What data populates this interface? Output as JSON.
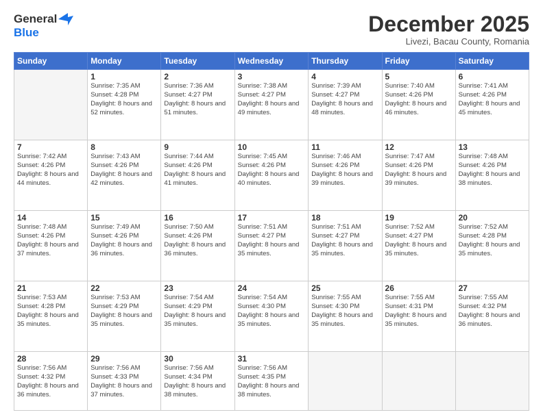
{
  "logo": {
    "line1": "General",
    "line2": "Blue"
  },
  "title": "December 2025",
  "subtitle": "Livezi, Bacau County, Romania",
  "header_days": [
    "Sunday",
    "Monday",
    "Tuesday",
    "Wednesday",
    "Thursday",
    "Friday",
    "Saturday"
  ],
  "weeks": [
    [
      {
        "day": "",
        "info": ""
      },
      {
        "day": "1",
        "info": "Sunrise: 7:35 AM\nSunset: 4:28 PM\nDaylight: 8 hours\nand 52 minutes."
      },
      {
        "day": "2",
        "info": "Sunrise: 7:36 AM\nSunset: 4:27 PM\nDaylight: 8 hours\nand 51 minutes."
      },
      {
        "day": "3",
        "info": "Sunrise: 7:38 AM\nSunset: 4:27 PM\nDaylight: 8 hours\nand 49 minutes."
      },
      {
        "day": "4",
        "info": "Sunrise: 7:39 AM\nSunset: 4:27 PM\nDaylight: 8 hours\nand 48 minutes."
      },
      {
        "day": "5",
        "info": "Sunrise: 7:40 AM\nSunset: 4:26 PM\nDaylight: 8 hours\nand 46 minutes."
      },
      {
        "day": "6",
        "info": "Sunrise: 7:41 AM\nSunset: 4:26 PM\nDaylight: 8 hours\nand 45 minutes."
      }
    ],
    [
      {
        "day": "7",
        "info": "Sunrise: 7:42 AM\nSunset: 4:26 PM\nDaylight: 8 hours\nand 44 minutes."
      },
      {
        "day": "8",
        "info": "Sunrise: 7:43 AM\nSunset: 4:26 PM\nDaylight: 8 hours\nand 42 minutes."
      },
      {
        "day": "9",
        "info": "Sunrise: 7:44 AM\nSunset: 4:26 PM\nDaylight: 8 hours\nand 41 minutes."
      },
      {
        "day": "10",
        "info": "Sunrise: 7:45 AM\nSunset: 4:26 PM\nDaylight: 8 hours\nand 40 minutes."
      },
      {
        "day": "11",
        "info": "Sunrise: 7:46 AM\nSunset: 4:26 PM\nDaylight: 8 hours\nand 39 minutes."
      },
      {
        "day": "12",
        "info": "Sunrise: 7:47 AM\nSunset: 4:26 PM\nDaylight: 8 hours\nand 39 minutes."
      },
      {
        "day": "13",
        "info": "Sunrise: 7:48 AM\nSunset: 4:26 PM\nDaylight: 8 hours\nand 38 minutes."
      }
    ],
    [
      {
        "day": "14",
        "info": "Sunrise: 7:48 AM\nSunset: 4:26 PM\nDaylight: 8 hours\nand 37 minutes."
      },
      {
        "day": "15",
        "info": "Sunrise: 7:49 AM\nSunset: 4:26 PM\nDaylight: 8 hours\nand 36 minutes."
      },
      {
        "day": "16",
        "info": "Sunrise: 7:50 AM\nSunset: 4:26 PM\nDaylight: 8 hours\nand 36 minutes."
      },
      {
        "day": "17",
        "info": "Sunrise: 7:51 AM\nSunset: 4:27 PM\nDaylight: 8 hours\nand 35 minutes."
      },
      {
        "day": "18",
        "info": "Sunrise: 7:51 AM\nSunset: 4:27 PM\nDaylight: 8 hours\nand 35 minutes."
      },
      {
        "day": "19",
        "info": "Sunrise: 7:52 AM\nSunset: 4:27 PM\nDaylight: 8 hours\nand 35 minutes."
      },
      {
        "day": "20",
        "info": "Sunrise: 7:52 AM\nSunset: 4:28 PM\nDaylight: 8 hours\nand 35 minutes."
      }
    ],
    [
      {
        "day": "21",
        "info": "Sunrise: 7:53 AM\nSunset: 4:28 PM\nDaylight: 8 hours\nand 35 minutes."
      },
      {
        "day": "22",
        "info": "Sunrise: 7:53 AM\nSunset: 4:29 PM\nDaylight: 8 hours\nand 35 minutes."
      },
      {
        "day": "23",
        "info": "Sunrise: 7:54 AM\nSunset: 4:29 PM\nDaylight: 8 hours\nand 35 minutes."
      },
      {
        "day": "24",
        "info": "Sunrise: 7:54 AM\nSunset: 4:30 PM\nDaylight: 8 hours\nand 35 minutes."
      },
      {
        "day": "25",
        "info": "Sunrise: 7:55 AM\nSunset: 4:30 PM\nDaylight: 8 hours\nand 35 minutes."
      },
      {
        "day": "26",
        "info": "Sunrise: 7:55 AM\nSunset: 4:31 PM\nDaylight: 8 hours\nand 35 minutes."
      },
      {
        "day": "27",
        "info": "Sunrise: 7:55 AM\nSunset: 4:32 PM\nDaylight: 8 hours\nand 36 minutes."
      }
    ],
    [
      {
        "day": "28",
        "info": "Sunrise: 7:56 AM\nSunset: 4:32 PM\nDaylight: 8 hours\nand 36 minutes."
      },
      {
        "day": "29",
        "info": "Sunrise: 7:56 AM\nSunset: 4:33 PM\nDaylight: 8 hours\nand 37 minutes."
      },
      {
        "day": "30",
        "info": "Sunrise: 7:56 AM\nSunset: 4:34 PM\nDaylight: 8 hours\nand 38 minutes."
      },
      {
        "day": "31",
        "info": "Sunrise: 7:56 AM\nSunset: 4:35 PM\nDaylight: 8 hours\nand 38 minutes."
      },
      {
        "day": "",
        "info": ""
      },
      {
        "day": "",
        "info": ""
      },
      {
        "day": "",
        "info": ""
      }
    ]
  ]
}
